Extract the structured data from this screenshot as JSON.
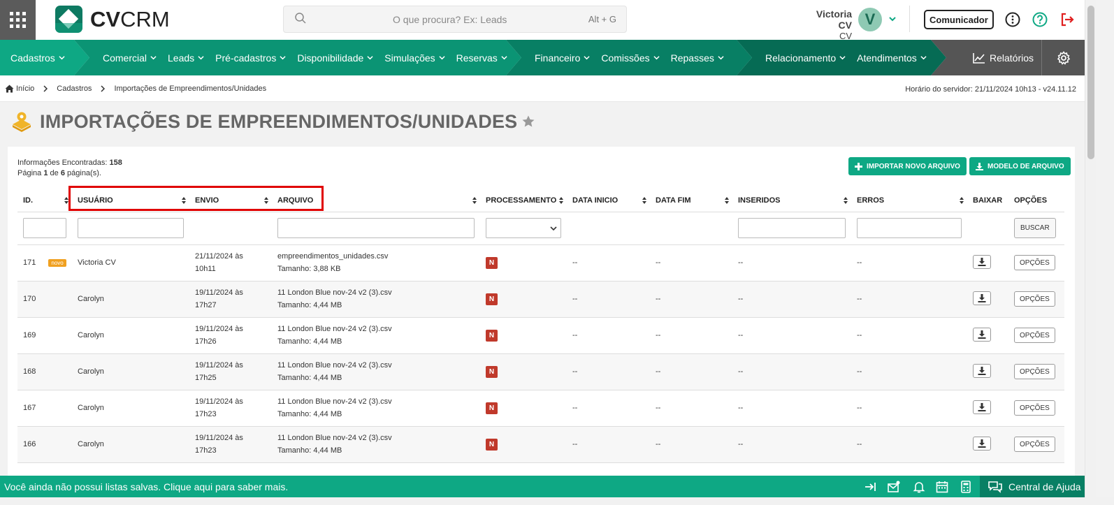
{
  "brand": {
    "logo_bold": "CV",
    "logo_thin": "CRM",
    "accent": "#0ea884",
    "dark_accent": "#087f64"
  },
  "search": {
    "placeholder": "O que procura? Ex: Leads",
    "shortcut": "Alt + G"
  },
  "user": {
    "name": "Victoria CV",
    "sub": "CV",
    "initial": "V"
  },
  "header": {
    "comunicador": "Comunicador"
  },
  "nav": {
    "cadastros": "Cadastros",
    "comercial": "Comercial",
    "leads": "Leads",
    "pre_cadastros": "Pré-cadastros",
    "disponibilidade": "Disponibilidade",
    "simulacoes": "Simulações",
    "reservas": "Reservas",
    "financeiro": "Financeiro",
    "comissoes": "Comissões",
    "repasses": "Repasses",
    "relacionamento": "Relacionamento",
    "atendimentos": "Atendimentos",
    "relatorios": "Relatórios"
  },
  "breadcrumb": {
    "home": "Início",
    "section": "Cadastros",
    "current": "Importações de Empreendimentos/Unidades"
  },
  "server_time": "Horário do servidor: 21/11/2024 10h13 - v24.11.12",
  "page": {
    "title": "IMPORTAÇÕES DE EMPREENDIMENTOS/UNIDADES"
  },
  "info": {
    "found_label": "Informações Encontradas:",
    "found_value": "158",
    "page_prefix": "Página",
    "page_current": "1",
    "page_of": "de",
    "page_total": "6",
    "page_suffix": "página(s)."
  },
  "actions": {
    "import": "IMPORTAR NOVO ARQUIVO",
    "model": "MODELO DE ARQUIVO"
  },
  "table": {
    "headers": {
      "id": "ID.",
      "usuario": "USUÁRIO",
      "envio": "ENVIO",
      "arquivo": "ARQUIVO",
      "processamento": "PROCESSAMENTO",
      "data_inicio": "DATA INICIO",
      "data_fim": "DATA FIM",
      "inseridos": "INSERIDOS",
      "erros": "ERROS",
      "baixar": "BAIXAR",
      "opcoes": "OPÇÕES"
    },
    "search_button": "BUSCAR",
    "options_label": "OPÇÕES",
    "rows": [
      {
        "id": "171",
        "badge": "novo",
        "user": "Victoria CV",
        "envio_1": "21/11/2024 às",
        "envio_2": "10h11",
        "file": "empreendimentos_unidades.csv",
        "size": "Tamanho: 3,88 KB",
        "proc": "N",
        "inicio": "--",
        "fim": "--",
        "inseridos": "--",
        "erros": "--"
      },
      {
        "id": "170",
        "badge": "",
        "user": "Carolyn",
        "envio_1": "19/11/2024 às",
        "envio_2": "17h27",
        "file": "11 London Blue nov-24 v2 (3).csv",
        "size": "Tamanho: 4,44 MB",
        "proc": "N",
        "inicio": "--",
        "fim": "--",
        "inseridos": "--",
        "erros": "--"
      },
      {
        "id": "169",
        "badge": "",
        "user": "Carolyn",
        "envio_1": "19/11/2024 às",
        "envio_2": "17h26",
        "file": "11 London Blue nov-24 v2 (3).csv",
        "size": "Tamanho: 4,44 MB",
        "proc": "N",
        "inicio": "--",
        "fim": "--",
        "inseridos": "--",
        "erros": "--"
      },
      {
        "id": "168",
        "badge": "",
        "user": "Carolyn",
        "envio_1": "19/11/2024 às",
        "envio_2": "17h25",
        "file": "11 London Blue nov-24 v2 (3).csv",
        "size": "Tamanho: 4,44 MB",
        "proc": "N",
        "inicio": "--",
        "fim": "--",
        "inseridos": "--",
        "erros": "--"
      },
      {
        "id": "167",
        "badge": "",
        "user": "Carolyn",
        "envio_1": "19/11/2024 às",
        "envio_2": "17h23",
        "file": "11 London Blue nov-24 v2 (3).csv",
        "size": "Tamanho: 4,44 MB",
        "proc": "N",
        "inicio": "--",
        "fim": "--",
        "inseridos": "--",
        "erros": "--"
      },
      {
        "id": "166",
        "badge": "",
        "user": "Carolyn",
        "envio_1": "19/11/2024 às",
        "envio_2": "17h23",
        "file": "11 London Blue nov-24 v2 (3).csv",
        "size": "Tamanho: 4,44 MB",
        "proc": "N",
        "inicio": "--",
        "fim": "--",
        "inseridos": "--",
        "erros": "--"
      }
    ]
  },
  "footer": {
    "message": "Você ainda não possui listas salvas. Clique aqui para saber mais.",
    "help": "Central de Ajuda"
  }
}
